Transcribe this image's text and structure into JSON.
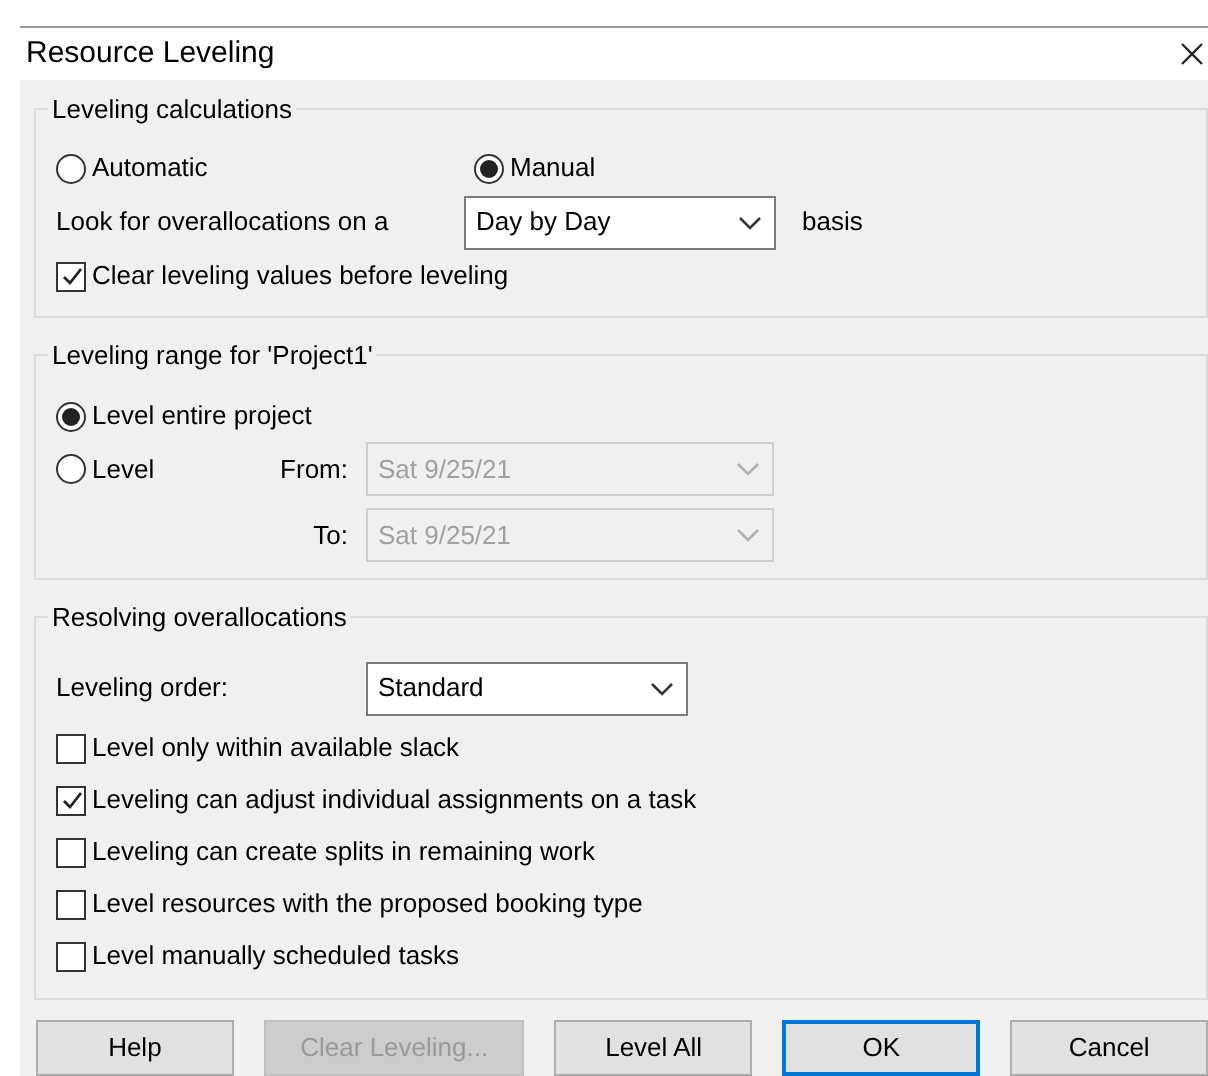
{
  "window": {
    "title": "Resource Leveling"
  },
  "calculations": {
    "title": "Leveling calculations",
    "modes": [
      {
        "label": "Automatic",
        "selected": false
      },
      {
        "label": "Manual",
        "selected": true
      }
    ],
    "look_for_prefix": "Look for overallocations on a",
    "basis": {
      "value": "Day by Day"
    },
    "look_for_suffix": "basis",
    "clear_values": {
      "label": "Clear leveling values before leveling",
      "checked": true
    }
  },
  "range": {
    "title": "Leveling range for 'Project1'",
    "options": [
      {
        "label": "Level entire project",
        "selected": true
      },
      {
        "label": "Level",
        "selected": false
      }
    ],
    "from": {
      "label": "From:",
      "value": "Sat 9/25/21",
      "disabled": true
    },
    "to": {
      "label": "To:",
      "value": "Sat 9/25/21",
      "disabled": true
    }
  },
  "resolving": {
    "title": "Resolving overallocations",
    "order_label": "Leveling order:",
    "order": {
      "value": "Standard"
    },
    "options": [
      {
        "label": "Level only within available slack",
        "checked": false
      },
      {
        "label": "Leveling can adjust individual assignments on a task",
        "checked": true
      },
      {
        "label": "Leveling can create splits in remaining work",
        "checked": false
      },
      {
        "label": "Level resources with the proposed booking type",
        "checked": false
      },
      {
        "label": "Level manually scheduled tasks",
        "checked": false
      }
    ]
  },
  "buttons": [
    {
      "label": "Help",
      "disabled": false,
      "default": false
    },
    {
      "label": "Clear Leveling...",
      "disabled": true,
      "default": false
    },
    {
      "label": "Level All",
      "disabled": false,
      "default": false
    },
    {
      "label": "OK",
      "disabled": false,
      "default": true
    },
    {
      "label": "Cancel",
      "disabled": false,
      "default": false
    }
  ]
}
